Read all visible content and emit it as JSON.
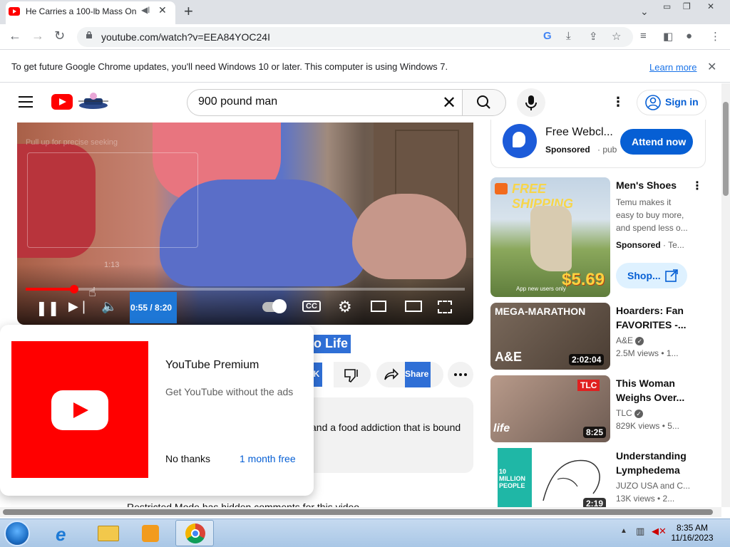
{
  "browser": {
    "tab_title": "He Carries a 100-lb Mass On",
    "new_tab": "+",
    "url": "youtube.com/watch?v=EEA84YOC24I",
    "infobar_text": "To get future Google Chrome updates, you'll need Windows 10 or later. This computer is using Windows 7.",
    "infobar_link": "Learn more"
  },
  "youtube": {
    "search_query": "900 pound man",
    "sign_in": "Sign in",
    "player": {
      "seek_hint": "Pull up for precise seeking",
      "thumb_time": "1:13",
      "time": "0:55 / 8:20",
      "progress": 0.11,
      "cc": "CC"
    },
    "title_fragment": "o Life",
    "like_fragment": "K",
    "share_label": "Share",
    "description_fragment": "and a food addiction that is bound",
    "restricted_text": "Restricted Mode has hidden comments for this video."
  },
  "premium_promo": {
    "title": "YouTube Premium",
    "subtitle": "Get YouTube without the ads",
    "no_thanks": "No thanks",
    "trial": "1 month free"
  },
  "ad": {
    "title": "Free Webcl...",
    "sponsored": "Sponsored",
    "publisher": "· pub",
    "cta": "Attend now"
  },
  "sidebar": {
    "shoes": {
      "banner": "FREE SHIPPING",
      "price": "$5.69",
      "note": "App new users only",
      "title": "Men's Shoes",
      "description": "Temu makes it easy to buy more, and spend less o...",
      "sponsored": "Sponsored",
      "advertiser": "· Te...",
      "shop": "Shop..."
    },
    "videos": [
      {
        "title": "Hoarders: Fan FAVORITES -...",
        "channel": "A&E",
        "meta": "2.5M views • 1...",
        "duration": "2:02:04",
        "overlay": "MEGA-MARATHON"
      },
      {
        "title": "This Woman Weighs Over...",
        "channel": "TLC",
        "meta": "829K views • 5...",
        "duration": "8:25",
        "overlay": "TLC"
      },
      {
        "title": "Understanding Lymphedema",
        "channel": "JUZO USA and C...",
        "meta": "13K views • 2...",
        "duration": "2:19",
        "overlay": "10 MILLION PEOPLE"
      }
    ]
  },
  "taskbar": {
    "time": "8:35 AM",
    "date": "11/16/2023"
  }
}
